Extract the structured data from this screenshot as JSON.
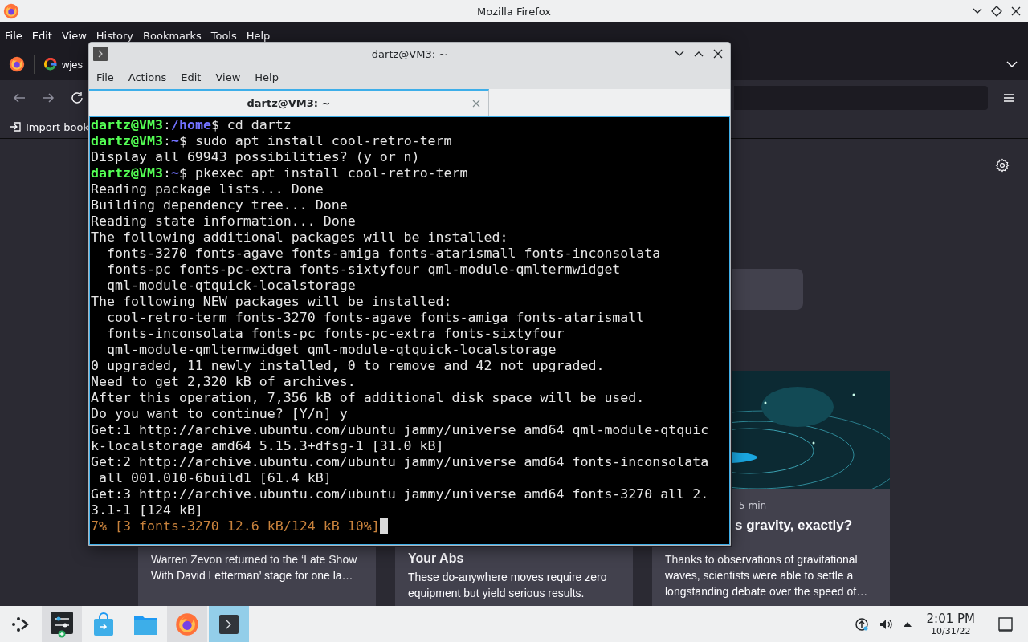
{
  "firefox": {
    "title": "Mozilla Firefox",
    "menu": [
      "File",
      "Edit",
      "View",
      "History",
      "Bookmarks",
      "Tools",
      "Help"
    ],
    "tab": {
      "label": "wjes"
    },
    "bookmark": "Import book"
  },
  "new_tab": {
    "cards": [
      {
        "kind": "text",
        "desc": "Warren Zevon returned to the ‘Late Show With David Letterman’ stage for one la…"
      },
      {
        "kind": "text",
        "title": "Your Abs",
        "desc": "These do-anywhere moves require zero equipment but yield serious results."
      },
      {
        "kind": "picture",
        "meta": "5 min",
        "title": "s gravity, exactly?",
        "desc": "Thanks to observations of gravitational waves, scientists were able to settle a longstanding debate over the speed of…"
      }
    ]
  },
  "terminal": {
    "title": "dartz@VM3: ~",
    "menu": [
      "File",
      "Actions",
      "Edit",
      "View",
      "Help"
    ],
    "tabs": [
      {
        "label": "dartz@VM3: ~",
        "selected": true
      }
    ],
    "cursor": true,
    "lines": [
      [
        {
          "kind": "user",
          "text": "dartz@VM3"
        },
        {
          "kind": "plain",
          "text": ":"
        },
        {
          "kind": "path",
          "text": "/home"
        },
        {
          "kind": "plain",
          "text": "$ cd dartz"
        }
      ],
      [
        {
          "kind": "user",
          "text": "dartz@VM3"
        },
        {
          "kind": "plain",
          "text": ":"
        },
        {
          "kind": "path",
          "text": "~"
        },
        {
          "kind": "plain",
          "text": "$ sudo apt install cool-retro-term"
        }
      ],
      [
        {
          "kind": "plain",
          "text": "Display all 69943 possibilities? (y or n)"
        }
      ],
      [
        {
          "kind": "user",
          "text": "dartz@VM3"
        },
        {
          "kind": "plain",
          "text": ":"
        },
        {
          "kind": "path",
          "text": "~"
        },
        {
          "kind": "plain",
          "text": "$ pkexec apt install cool-retro-term"
        }
      ],
      [
        {
          "kind": "plain",
          "text": "Reading package lists... Done"
        }
      ],
      [
        {
          "kind": "plain",
          "text": "Building dependency tree... Done"
        }
      ],
      [
        {
          "kind": "plain",
          "text": "Reading state information... Done"
        }
      ],
      [
        {
          "kind": "plain",
          "text": "The following additional packages will be installed:"
        }
      ],
      [
        {
          "kind": "plain",
          "text": "  fonts-3270 fonts-agave fonts-amiga fonts-atarismall fonts-inconsolata"
        }
      ],
      [
        {
          "kind": "plain",
          "text": "  fonts-pc fonts-pc-extra fonts-sixtyfour qml-module-qmltermwidget"
        }
      ],
      [
        {
          "kind": "plain",
          "text": "  qml-module-qtquick-localstorage"
        }
      ],
      [
        {
          "kind": "plain",
          "text": "The following NEW packages will be installed:"
        }
      ],
      [
        {
          "kind": "plain",
          "text": "  cool-retro-term fonts-3270 fonts-agave fonts-amiga fonts-atarismall"
        }
      ],
      [
        {
          "kind": "plain",
          "text": "  fonts-inconsolata fonts-pc fonts-pc-extra fonts-sixtyfour"
        }
      ],
      [
        {
          "kind": "plain",
          "text": "  qml-module-qmltermwidget qml-module-qtquick-localstorage"
        }
      ],
      [
        {
          "kind": "plain",
          "text": "0 upgraded, 11 newly installed, 0 to remove and 42 not upgraded."
        }
      ],
      [
        {
          "kind": "plain",
          "text": "Need to get 2,320 kB of archives."
        }
      ],
      [
        {
          "kind": "plain",
          "text": "After this operation, 7,356 kB of additional disk space will be used."
        }
      ],
      [
        {
          "kind": "plain",
          "text": "Do you want to continue? [Y/n] y"
        }
      ],
      [
        {
          "kind": "plain",
          "text": "Get:1 http://archive.ubuntu.com/ubuntu jammy/universe amd64 qml-module-qtquic"
        }
      ],
      [
        {
          "kind": "plain",
          "text": "k-localstorage amd64 5.15.3+dfsg-1 [31.0 kB]"
        }
      ],
      [
        {
          "kind": "plain",
          "text": "Get:2 http://archive.ubuntu.com/ubuntu jammy/universe amd64 fonts-inconsolata"
        }
      ],
      [
        {
          "kind": "plain",
          "text": " all 001.010-6build1 [61.4 kB]"
        }
      ],
      [
        {
          "kind": "plain",
          "text": "Get:3 http://archive.ubuntu.com/ubuntu jammy/universe amd64 fonts-3270 all 2."
        }
      ],
      [
        {
          "kind": "plain",
          "text": "3.1-1 [124 kB]"
        }
      ],
      [
        {
          "kind": "progress",
          "text": "7% [3 fonts-3270 12.6 kB/124 kB 10%]"
        }
      ]
    ]
  },
  "taskbar": {
    "apps": [
      {
        "kind": "launcher",
        "running": false,
        "selected": false
      },
      {
        "kind": "settings",
        "running": true,
        "selected": false
      },
      {
        "kind": "store",
        "running": false,
        "selected": false
      },
      {
        "kind": "folder",
        "running": false,
        "selected": false
      },
      {
        "kind": "firefox",
        "running": true,
        "selected": false
      },
      {
        "kind": "terminal",
        "running": true,
        "selected": true
      }
    ],
    "time": "2:01 PM",
    "date": "10/31/22"
  }
}
